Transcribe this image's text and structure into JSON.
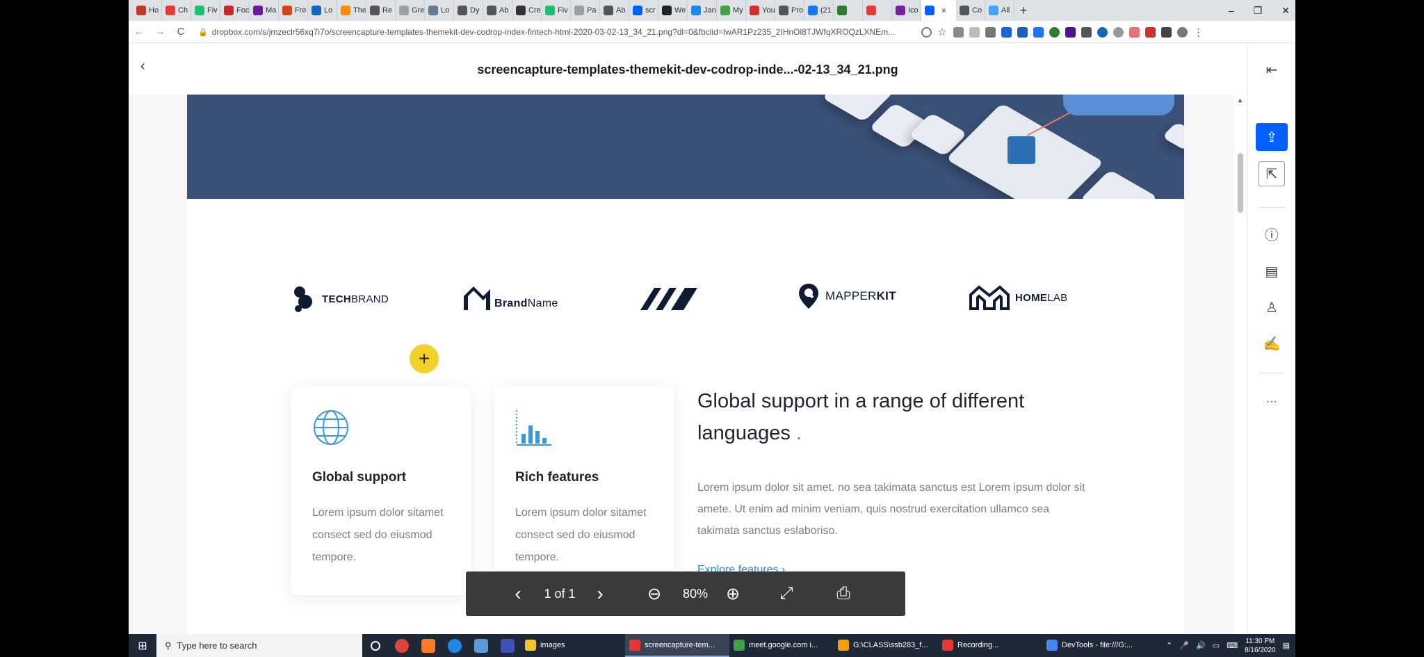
{
  "browser": {
    "tabs": [
      {
        "label": "Ho",
        "color": "#c0392b"
      },
      {
        "label": "Ch",
        "color": "#e53935"
      },
      {
        "label": "Fiv",
        "color": "#1dbf73"
      },
      {
        "label": "Foc",
        "color": "#c62828"
      },
      {
        "label": "Ma",
        "color": "#6a1b9a"
      },
      {
        "label": "Fre",
        "color": "#d84315"
      },
      {
        "label": "Lo",
        "color": "#1565c0"
      },
      {
        "label": "The",
        "color": "#fb8c00"
      },
      {
        "label": "Re",
        "color": "#555555"
      },
      {
        "label": "Gre",
        "color": "#9e9e9e"
      },
      {
        "label": "Lo",
        "color": "#607d8b"
      },
      {
        "label": "Dy",
        "color": "#555555"
      },
      {
        "label": "Ab",
        "color": "#555555"
      },
      {
        "label": "Cre",
        "color": "#333333"
      },
      {
        "label": "Fiv",
        "color": "#1dbf73"
      },
      {
        "label": "Pa",
        "color": "#9e9e9e"
      },
      {
        "label": "Ab",
        "color": "#555555"
      },
      {
        "label": "scr",
        "color": "#0061fe"
      },
      {
        "label": "We",
        "color": "#222222"
      },
      {
        "label": "Jan",
        "color": "#1e88e5"
      },
      {
        "label": "My",
        "color": "#43a047"
      },
      {
        "label": "You",
        "color": "#d32f2f"
      },
      {
        "label": "Pro",
        "color": "#555555"
      },
      {
        "label": "(21",
        "color": "#1877f2"
      },
      {
        "label": "",
        "color": "#2e7d32"
      },
      {
        "label": "",
        "color": "#e53935"
      },
      {
        "label": "Ico",
        "color": "#7b1fa2"
      }
    ],
    "active_tab": {
      "label": "",
      "color": "#0061fe",
      "close": "×"
    },
    "tail_tabs": [
      {
        "label": "Co",
        "color": "#555555"
      },
      {
        "label": "All",
        "color": "#42a5f5"
      }
    ],
    "new_tab": "+",
    "window_controls": {
      "minimize": "–",
      "restore": "❐",
      "close": "✕"
    },
    "nav": {
      "back": "←",
      "forward": "→",
      "reload": "C"
    },
    "url": "dropbox.com/s/jmzeclr56xq7i7o/screencapture-templates-themekit-dev-codrop-index-fintech-html-2020-03-02-13_34_21.png?dl=0&fbclid=IwAR1Pz235_2IHnOl8TJWfqXROQzLXNEm...",
    "lock_icon": "🔒"
  },
  "viewer": {
    "back": "‹",
    "title": "screencapture-templates-themekit-dev-codrop-inde...-02-13_34_21.png",
    "rail": {
      "collapse": "⇤",
      "share": "⇪",
      "open_external": "⇱",
      "info": "ⓘ",
      "comment": "▤",
      "stamp": "♙",
      "sign": "✍",
      "more": "···"
    }
  },
  "page": {
    "logos": [
      {
        "bold": "TECH",
        "thin": "BRAND"
      },
      {
        "bold": "Brand",
        "thin": "Name"
      },
      {
        "bold": "",
        "thin": ""
      },
      {
        "bold": "MAPPER",
        "thin": "KIT"
      },
      {
        "bold": "HOME",
        "thin": "LAB"
      }
    ],
    "cards": [
      {
        "title": "Global support",
        "text": "Lorem ipsum dolor sitamet consect sed do eiusmod tempore."
      },
      {
        "title": "Rich features",
        "text": "Lorem ipsum dolor sitamet consect sed do eiusmod tempore."
      }
    ],
    "feature": {
      "title": "Global support in a range of different languages",
      "dot": ".",
      "text": "Lorem ipsum dolor sit amet. no sea takimata sanctus est Lorem ipsum dolor sit amete. Ut enim ad minim veniam, quis nostrud exercitation ullamco sea takimata sanctus eslaboriso.",
      "link": "Explore features  ›"
    }
  },
  "pdf_toolbar": {
    "prev": "‹",
    "page_indicator": "1 of 1",
    "next": "›",
    "zoom_out": "⊖",
    "zoom": "80%",
    "zoom_in": "⊕",
    "fullscreen": "⤢",
    "print": "⎙"
  },
  "taskbar": {
    "start": "⊞",
    "search_placeholder": "Type here to search",
    "tasks": [
      {
        "label": "images",
        "color": "#f4c430"
      },
      {
        "label": "screencapture-tem...",
        "color": "#e53935",
        "active": true
      },
      {
        "label": "meet.google.com i...",
        "color": "#43a047"
      },
      {
        "label": "G:\\CLASS\\ssb283_f...",
        "color": "#f4a000"
      },
      {
        "label": "Recording...",
        "color": "#e53935"
      },
      {
        "label": "DevTools - file:///G:...",
        "color": "#4285f4"
      }
    ],
    "clock_time": "11:30 PM",
    "clock_date": "8/16/2020"
  }
}
